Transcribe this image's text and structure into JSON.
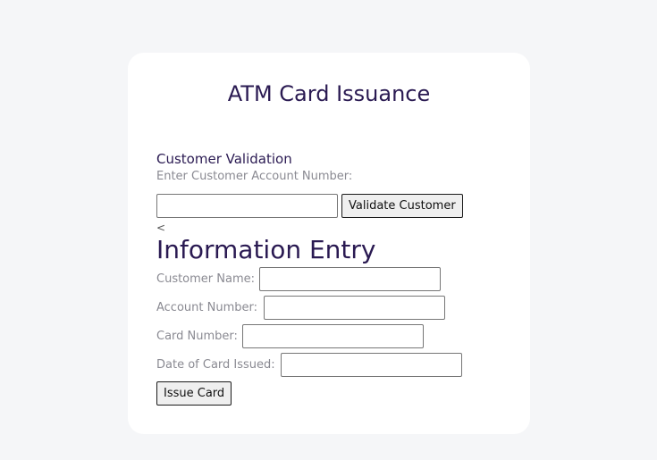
{
  "card": {
    "title": "ATM Card Issuance"
  },
  "validation": {
    "section_label": "Customer Validation",
    "hint": "Enter Customer Account Number:",
    "account_input_value": "",
    "validate_button": "Validate Customer",
    "stray_text": "<"
  },
  "entry": {
    "heading": "Information Entry",
    "fields": [
      {
        "label": "Customer Name:",
        "value": ""
      },
      {
        "label": "Account Number:",
        "value": ""
      },
      {
        "label": "Card Number:",
        "value": ""
      },
      {
        "label": "Date of Card Issued:",
        "value": ""
      }
    ],
    "issue_button": "Issue Card"
  }
}
